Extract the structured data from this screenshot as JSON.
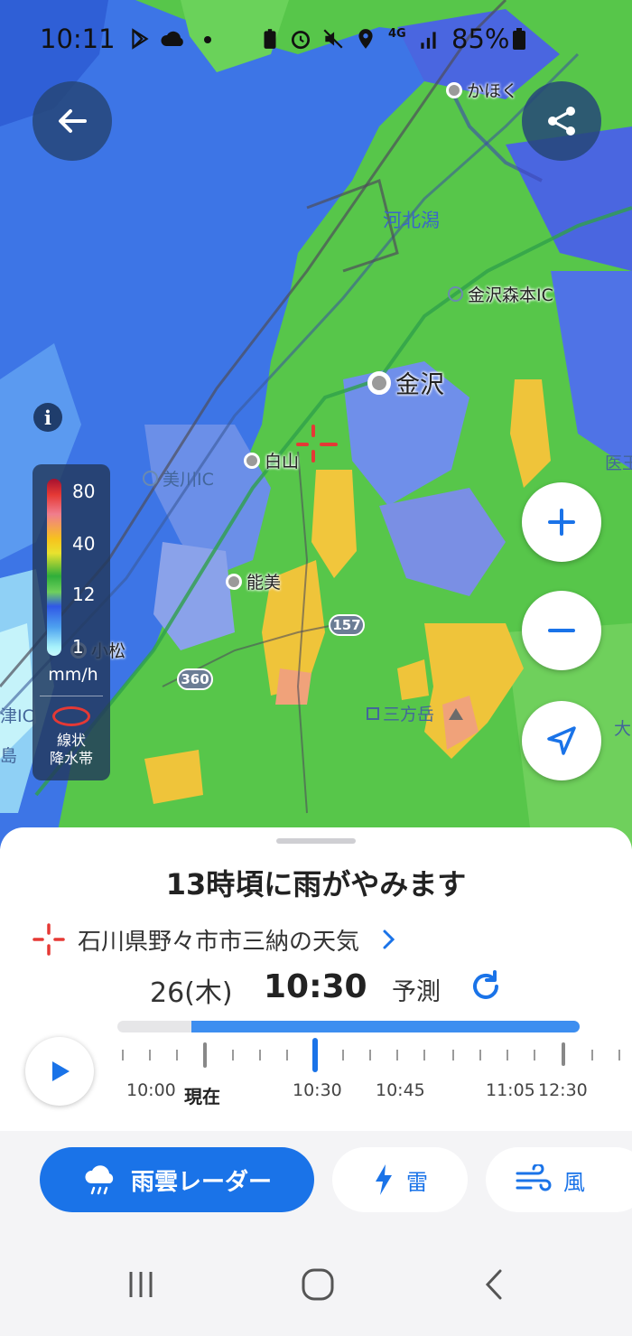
{
  "status_bar": {
    "time": "10:11",
    "network": "4G",
    "battery": "85%"
  },
  "map": {
    "legend": {
      "values": [
        "80",
        "40",
        "12",
        "1"
      ],
      "unit": "mm/h",
      "band_label_1": "線状",
      "band_label_2": "降水帯"
    },
    "places": {
      "kahoku": "かほく",
      "kahokugata": "河北潟",
      "kanazawa_morimoto_ic": "金沢森本IC",
      "kanazawa": "金沢",
      "hakusan": "白山",
      "mikawa_ic": "美川IC",
      "nomi": "能美",
      "komatsu": "小松",
      "sannpogatake": "三方岳",
      "edge_ic": "津IC",
      "edge_right_1": "医王",
      "edge_right_2": "大",
      "edge_left": "島"
    },
    "roads": {
      "route_157": "157",
      "route_360": "360"
    }
  },
  "sheet": {
    "headline": "13時頃に雨がやみます",
    "location": "石川県野々市市三納の天気",
    "date": "26(木)",
    "time": "10:30",
    "forecast_label": "予測",
    "progress": {
      "past_fraction": 0.16,
      "forecast_fraction": 0.84
    },
    "timeline_labels": {
      "t1000": "10:00",
      "now": "現在",
      "t1030": "10:30",
      "t1045": "10:45",
      "t1105": "11:05",
      "t1230": "12:30"
    }
  },
  "tabs": {
    "radar": "雨雲レーダー",
    "thunder": "雷",
    "wind": "風"
  },
  "colors": {
    "accent": "#1a73e8",
    "rain_light": "#3f78e8",
    "rain_mid": "#5fcf4f",
    "rain_heavy": "#f0c43a"
  }
}
